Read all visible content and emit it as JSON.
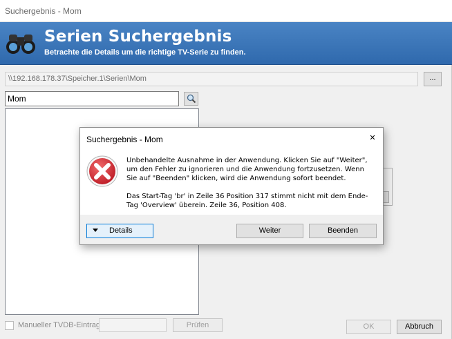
{
  "window": {
    "title": "Suchergebnis - Mom"
  },
  "banner": {
    "heading": "Serien Suchergebnis",
    "subtitle": "Betrachte die Details um die richtige TV-Serie zu finden.",
    "icon": "binoculars-icon",
    "color": "#3a76b8"
  },
  "path": {
    "value": "\\\\192.168.178.37\\Speicher.1\\Serien\\Mom",
    "browse_label": "..."
  },
  "search": {
    "value": "Mom",
    "icon": "magnifier-icon"
  },
  "results": [],
  "manual": {
    "checkbox_label": "Manueller TVDB-Eintrag:",
    "checked": false,
    "input_value": "",
    "check_label": "Prüfen"
  },
  "buttons": {
    "ok": "OK",
    "cancel": "Abbruch"
  },
  "dialog": {
    "title": "Suchergebnis - Mom",
    "close_glyph": "✕",
    "icon": "error-icon",
    "message": "Unbehandelte Ausnahme in der Anwendung. Klicken Sie auf \"Weiter\", um den Fehler zu ignorieren und die Anwendung fortzusetzen. Wenn Sie auf \"Beenden\" klicken, wird die Anwendung sofort beendet.",
    "detail_message": "Das Start-Tag 'br' in Zeile 36 Position 317 stimmt nicht mit dem Ende-Tag 'Overview' überein. Zeile 36, Position 408.",
    "details_label": "Details",
    "continue_label": "Weiter",
    "quit_label": "Beenden",
    "error_color": "#d9363e"
  }
}
